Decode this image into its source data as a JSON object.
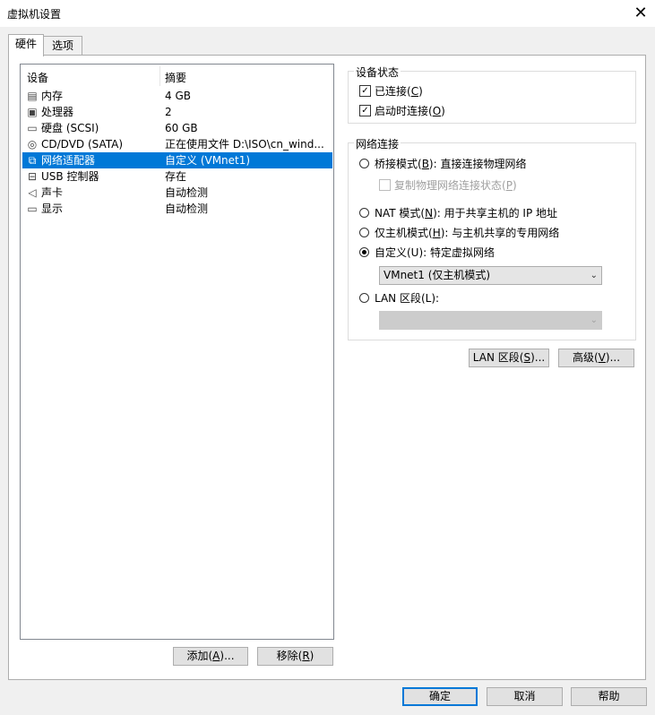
{
  "window": {
    "title": "虚拟机设置",
    "close_glyph": "✕"
  },
  "tabs": [
    {
      "label": "硬件",
      "active": true
    },
    {
      "label": "选项",
      "active": false
    }
  ],
  "device_list": {
    "headers": {
      "device": "设备",
      "summary": "摘要"
    },
    "rows": [
      {
        "icon": "memory-icon",
        "glyph": "▤",
        "name": "内存",
        "summary": "4 GB",
        "selected": false
      },
      {
        "icon": "processor-icon",
        "glyph": "▣",
        "name": "处理器",
        "summary": "2",
        "selected": false
      },
      {
        "icon": "harddisk-icon",
        "glyph": "▭",
        "name": "硬盘 (SCSI)",
        "summary": "60 GB",
        "selected": false
      },
      {
        "icon": "cd-dvd-icon",
        "glyph": "◎",
        "name": "CD/DVD (SATA)",
        "summary": "正在使用文件 D:\\ISO\\cn_wind...",
        "selected": false
      },
      {
        "icon": "network-adapter-icon",
        "glyph": "⧉",
        "name": "网络适配器",
        "summary": "自定义 (VMnet1)",
        "selected": true
      },
      {
        "icon": "usb-icon",
        "glyph": "⊟",
        "name": "USB 控制器",
        "summary": "存在",
        "selected": false
      },
      {
        "icon": "sound-card-icon",
        "glyph": "◁",
        "name": "声卡",
        "summary": "自动检测",
        "selected": false
      },
      {
        "icon": "display-icon",
        "glyph": "▭",
        "name": "显示",
        "summary": "自动检测",
        "selected": false
      }
    ]
  },
  "list_buttons": {
    "add": {
      "text": "添加(",
      "key": "A",
      "tail": ")..."
    },
    "remove": {
      "text": "移除(",
      "key": "R",
      "tail": ")"
    }
  },
  "device_status": {
    "title": "设备状态",
    "connected": {
      "text": "已连接(",
      "key": "C",
      "tail": ")",
      "checked": true,
      "mark": "✓"
    },
    "connect_at_power_on": {
      "text": "启动时连接(",
      "key": "O",
      "tail": ")",
      "checked": true,
      "mark": "✓"
    }
  },
  "network": {
    "title": "网络连接",
    "bridged": {
      "text": "桥接模式(",
      "key": "B",
      "tail": "): 直接连接物理网络",
      "selected": false
    },
    "replicate": {
      "text": "复制物理网络连接状态(",
      "key": "P",
      "tail": ")",
      "checked": false,
      "disabled": true
    },
    "nat": {
      "text": "NAT 模式(",
      "key": "N",
      "tail": "): 用于共享主机的 IP 地址",
      "selected": false
    },
    "host_only": {
      "text": "仅主机模式(",
      "key": "H",
      "tail": "): 与主机共享的专用网络",
      "selected": false
    },
    "custom": {
      "text": "自定义(U): 特定虚拟网络",
      "selected": true
    },
    "custom_select": {
      "value": "VMnet1 (仅主机模式)",
      "arrow": "⌄"
    },
    "lan_segment": {
      "text": "LAN 区段(L):",
      "selected": false
    },
    "lan_select": {
      "value": "",
      "arrow": "⌄",
      "disabled": true
    }
  },
  "panel_buttons": {
    "lan_segments": {
      "text": "LAN 区段(",
      "key": "S",
      "tail": ")..."
    },
    "advanced": {
      "text": "高级(",
      "key": "V",
      "tail": ")..."
    }
  },
  "footer": {
    "ok": "确定",
    "cancel": "取消",
    "help": "帮助"
  }
}
